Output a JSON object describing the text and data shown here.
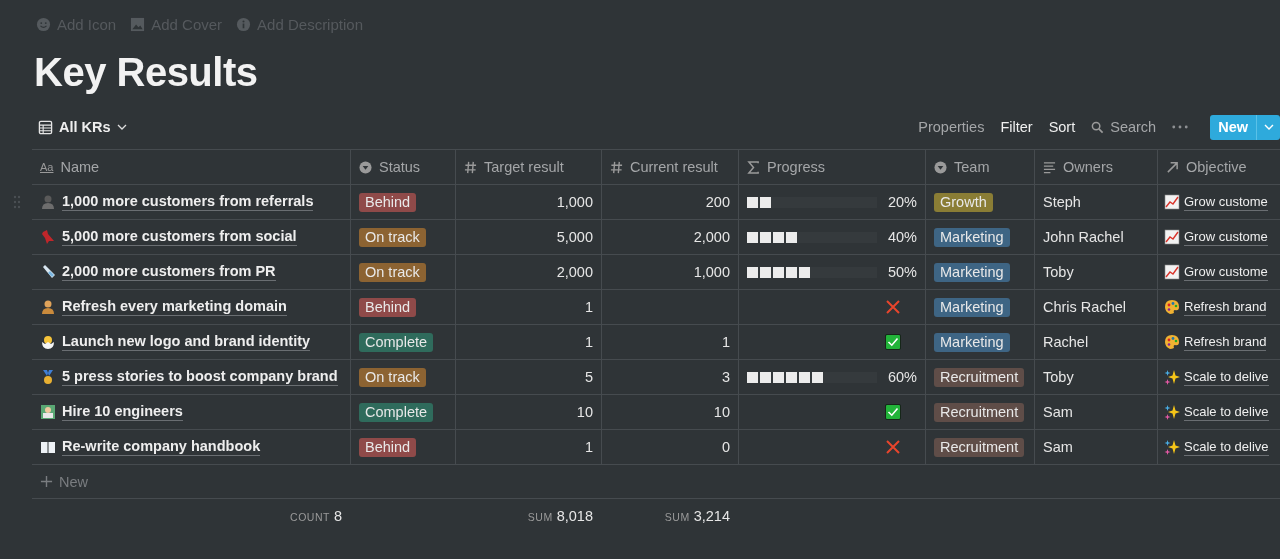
{
  "page_actions": [
    {
      "kind": "icon",
      "label": "Add Icon"
    },
    {
      "kind": "cover",
      "label": "Add Cover"
    },
    {
      "kind": "description",
      "label": "Add Description"
    }
  ],
  "title": "Key Results",
  "view": {
    "label": "All KRs"
  },
  "toolbar": [
    {
      "kind": "text",
      "label": "Properties",
      "active": false
    },
    {
      "kind": "text",
      "label": "Filter",
      "active": true
    },
    {
      "kind": "text",
      "label": "Sort",
      "active": true
    },
    {
      "kind": "search",
      "label": "Search",
      "active": false
    },
    {
      "kind": "more"
    }
  ],
  "new_button": {
    "label": "New"
  },
  "table": {
    "columns": [
      {
        "kind": "title",
        "glyph": "Aa",
        "label": "Name",
        "calc": {
          "label": "COUNT",
          "value": "8"
        }
      },
      {
        "kind": "select",
        "label": "Status"
      },
      {
        "kind": "number",
        "label": "Target result",
        "calc": {
          "label": "SUM",
          "value": "8,018"
        }
      },
      {
        "kind": "number",
        "label": "Current result",
        "calc": {
          "label": "SUM",
          "value": "3,214"
        }
      },
      {
        "kind": "formula",
        "label": "Progress"
      },
      {
        "kind": "select",
        "label": "Team"
      },
      {
        "kind": "text",
        "label": "Owners"
      },
      {
        "kind": "relation",
        "label": "Objective"
      }
    ],
    "rows": [
      {
        "name": "1,000 more customers from referrals",
        "status": {
          "label": "Behind",
          "color": "#8f4a49"
        },
        "target": "1,000",
        "current": "200",
        "progress": {
          "kind": "bar",
          "level": 0.2,
          "reading": "20%"
        },
        "team": {
          "label": "Growth",
          "color": "#8a7d35"
        },
        "owners": "Steph",
        "objective": "Grow custome"
      },
      {
        "name": "5,000 more customers from social",
        "status": {
          "label": "On track",
          "color": "#8c6332"
        },
        "target": "5,000",
        "current": "2,000",
        "progress": {
          "kind": "bar",
          "level": 0.4,
          "reading": "40%"
        },
        "team": {
          "label": "Marketing",
          "color": "#3e6584"
        },
        "owners": "John Rachel",
        "objective": "Grow custome"
      },
      {
        "name": "2,000 more customers from PR",
        "status": {
          "label": "On track",
          "color": "#8c6332"
        },
        "target": "2,000",
        "current": "1,000",
        "progress": {
          "kind": "bar",
          "level": 0.5,
          "reading": "50%"
        },
        "team": {
          "label": "Marketing",
          "color": "#3e6584"
        },
        "owners": "Toby",
        "objective": "Grow custome"
      },
      {
        "name": "Refresh every marketing domain",
        "status": {
          "label": "Behind",
          "color": "#8f4a49"
        },
        "target": "1",
        "current": "",
        "progress": {
          "kind": "cross"
        },
        "team": {
          "label": "Marketing",
          "color": "#3e6584"
        },
        "owners": "Chris Rachel",
        "objective": "Refresh brand"
      },
      {
        "name": "Launch new logo and brand identity",
        "status": {
          "label": "Complete",
          "color": "#2f6b5c"
        },
        "target": "1",
        "current": "1",
        "progress": {
          "kind": "check"
        },
        "team": {
          "label": "Marketing",
          "color": "#3e6584"
        },
        "owners": "Rachel",
        "objective": "Refresh brand"
      },
      {
        "name": "5 press stories to boost company brand",
        "status": {
          "label": "On track",
          "color": "#8c6332"
        },
        "target": "5",
        "current": "3",
        "progress": {
          "kind": "bar",
          "level": 0.6,
          "reading": "60%"
        },
        "team": {
          "label": "Recruitment",
          "color": "#5f4d48"
        },
        "owners": "Toby",
        "objective": "Scale to delive"
      },
      {
        "name": "Hire 10 engineers",
        "status": {
          "label": "Complete",
          "color": "#2f6b5c"
        },
        "target": "10",
        "current": "10",
        "progress": {
          "kind": "check"
        },
        "team": {
          "label": "Recruitment",
          "color": "#5f4d48"
        },
        "owners": "Sam",
        "objective": "Scale to delive"
      },
      {
        "name": "Re-write company handbook",
        "status": {
          "label": "Behind",
          "color": "#8f4a49"
        },
        "target": "1",
        "current": "0",
        "progress": {
          "kind": "cross"
        },
        "team": {
          "label": "Recruitment",
          "color": "#5f4d48"
        },
        "owners": "Sam",
        "objective": "Scale to delive"
      }
    ],
    "new_row": "New"
  }
}
